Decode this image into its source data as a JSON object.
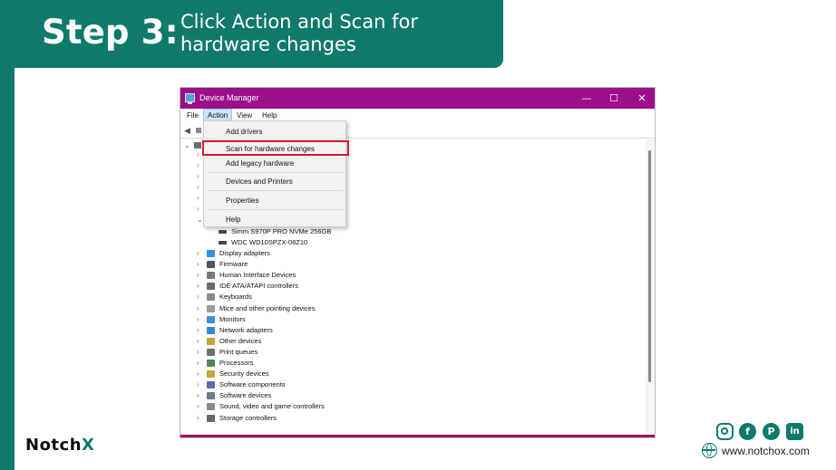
{
  "banner": {
    "step": "Step 3:",
    "description": "Click Action and Scan for hardware changes"
  },
  "window": {
    "title": "Device Manager",
    "buttons": {
      "minimize": "—",
      "maximize": "☐",
      "close": "✕"
    },
    "menu": [
      "File",
      "Action",
      "View",
      "Help"
    ],
    "active_menu": "Action",
    "dropdown": {
      "items": [
        "Add drivers",
        "Scan for hardware changes",
        "Add legacy hardware",
        "Devices and Printers",
        "Properties",
        "Help"
      ],
      "highlighted": "Scan for hardware changes"
    },
    "disk_drives": [
      "Simm S970P PRO NVMe 256GB",
      "WDC WD10SPZX-08Z10"
    ],
    "categories": [
      {
        "label": "Display adapters",
        "icon": "display-adapter-icon",
        "color": "#3c8fd6"
      },
      {
        "label": "Firmware",
        "icon": "firmware-icon",
        "color": "#555555"
      },
      {
        "label": "Human Interface Devices",
        "icon": "hid-icon",
        "color": "#7a7a7a"
      },
      {
        "label": "IDE ATA/ATAPI controllers",
        "icon": "ide-controller-icon",
        "color": "#6a6a6a"
      },
      {
        "label": "Keyboards",
        "icon": "keyboard-icon",
        "color": "#8a8a8a"
      },
      {
        "label": "Mice and other pointing devices",
        "icon": "mouse-icon",
        "color": "#9a9a9a"
      },
      {
        "label": "Monitors",
        "icon": "monitor-icon",
        "color": "#3c8fd6"
      },
      {
        "label": "Network adapters",
        "icon": "network-adapter-icon",
        "color": "#2e8bc8"
      },
      {
        "label": "Other devices",
        "icon": "other-devices-icon",
        "color": "#c9a23a"
      },
      {
        "label": "Print queues",
        "icon": "printer-icon",
        "color": "#707070"
      },
      {
        "label": "Processors",
        "icon": "processor-icon",
        "color": "#4a8c4a"
      },
      {
        "label": "Security devices",
        "icon": "security-device-icon",
        "color": "#c9a23a"
      },
      {
        "label": "Software components",
        "icon": "software-component-icon",
        "color": "#5b6f9e"
      },
      {
        "label": "Software devices",
        "icon": "software-device-icon",
        "color": "#6a7a8a"
      },
      {
        "label": "Sound, video and game controllers",
        "icon": "sound-icon",
        "color": "#8a8a8a"
      },
      {
        "label": "Storage controllers",
        "icon": "storage-controller-icon",
        "color": "#6a6a6a"
      }
    ]
  },
  "footer": {
    "logo": "Notch",
    "logo_mark": "X",
    "website": "www.notchox.com",
    "social": {
      "instagram": "",
      "facebook": "f",
      "pinterest": "P",
      "linkedin": "in"
    }
  },
  "colors": {
    "brand": "#0f7a6c",
    "titlebar": "#9c0e8a",
    "highlight": "#d0202c"
  }
}
